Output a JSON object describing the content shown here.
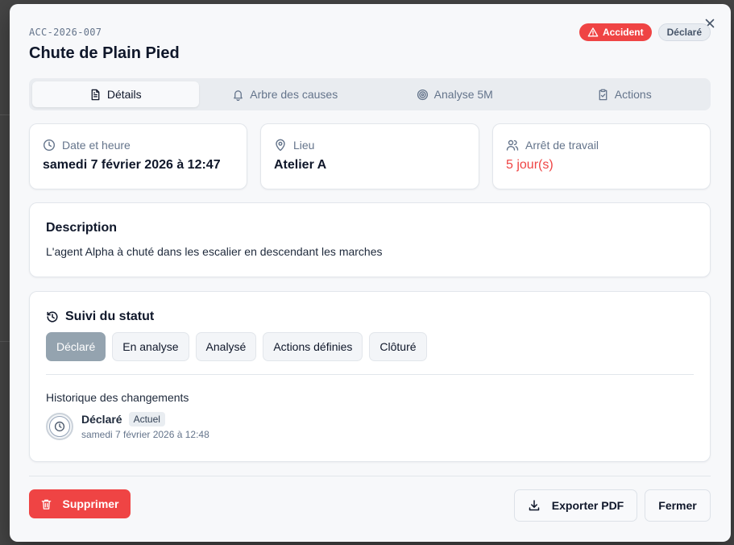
{
  "incident": {
    "reference": "ACC-2026-007",
    "title": "Chute de Plain Pied",
    "type_badge": "Accident",
    "status_badge": "Déclaré"
  },
  "tabs": [
    {
      "label": "Détails",
      "icon": "file-text-icon",
      "active": true
    },
    {
      "label": "Arbre des causes",
      "icon": "bell-icon",
      "active": false
    },
    {
      "label": "Analyse 5M",
      "icon": "target-icon",
      "active": false
    },
    {
      "label": "Actions",
      "icon": "clipboard-check-icon",
      "active": false
    }
  ],
  "info": {
    "date": {
      "label": "Date et heure",
      "value": "samedi 7 février 2026 à 12:47"
    },
    "location": {
      "label": "Lieu",
      "value": "Atelier A"
    },
    "work_stoppage": {
      "label": "Arrêt de travail",
      "value": "5 jour(s)"
    }
  },
  "description": {
    "title": "Description",
    "text": "L'agent Alpha à chuté dans les escalier en descendant les marches"
  },
  "status_tracking": {
    "title": "Suivi du statut",
    "steps": [
      {
        "label": "Déclaré",
        "active": true
      },
      {
        "label": "En analyse",
        "active": false
      },
      {
        "label": "Analysé",
        "active": false
      },
      {
        "label": "Actions définies",
        "active": false
      },
      {
        "label": "Clôturé",
        "active": false
      }
    ],
    "history_title": "Historique des changements",
    "history": [
      {
        "status": "Déclaré",
        "tag": "Actuel",
        "date": "samedi 7 février 2026 à 12:48"
      }
    ]
  },
  "footer": {
    "delete_label": "Supprimer",
    "export_label": "Exporter PDF",
    "close_label": "Fermer"
  },
  "colors": {
    "danger": "#ef4444",
    "active_step": "#94a3af",
    "muted_text": "#64748b"
  }
}
